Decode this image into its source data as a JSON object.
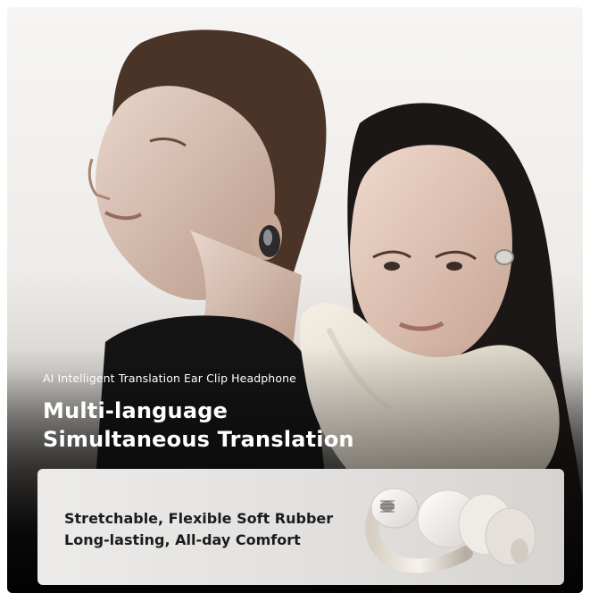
{
  "hero": {
    "subtitle": "AI Intelligent Translation Ear Clip Headphone",
    "headline_line1": "Multi-language",
    "headline_line2": "Simultaneous Translation"
  },
  "feature_card": {
    "line1": "Stretchable, Flexible Soft Rubber",
    "line2": "Long-lasting, All-day Comfort"
  },
  "colors": {
    "headline_text": "#ffffff",
    "card_background": "#e6e4e2",
    "card_text": "#1c1c1c"
  }
}
